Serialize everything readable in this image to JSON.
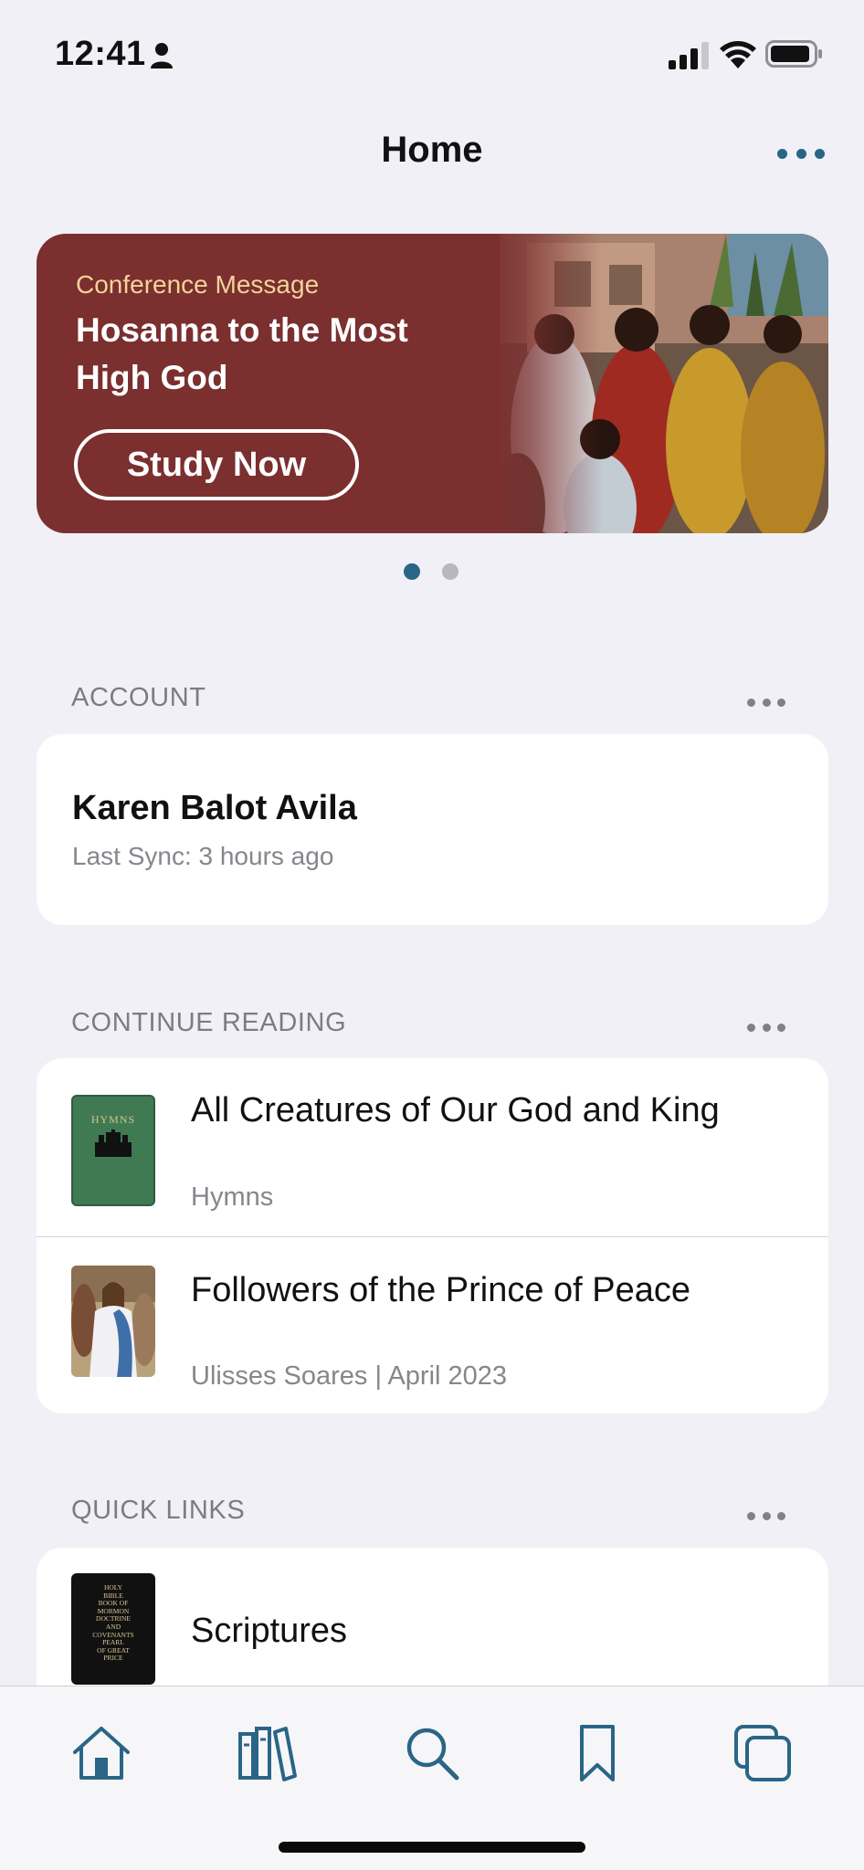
{
  "status_bar": {
    "time": "12:41"
  },
  "nav": {
    "title": "Home"
  },
  "banner": {
    "eyebrow": "Conference Message",
    "title": "Hosanna to the Most High God",
    "cta_label": "Study Now",
    "bg_color": "#7b2f2f",
    "eyebrow_color": "#f3d39a"
  },
  "pager": {
    "count": 2,
    "active": 1
  },
  "account": {
    "header": "ACCOUNT",
    "name": "Karen Balot Avila",
    "last_sync": "Last Sync: 3 hours ago"
  },
  "continue_reading": {
    "header": "CONTINUE READING",
    "items": [
      {
        "title": "All Creatures of Our God and King",
        "subtitle": "Hymns",
        "thumb": "hymns-book-cover",
        "thumb_text": "HYMNS"
      },
      {
        "title": "Followers of the Prince of Peace",
        "subtitle": "Ulisses Soares | April 2023",
        "thumb": "christ-painting"
      }
    ]
  },
  "quick_links": {
    "header": "QUICK LINKS",
    "items": [
      {
        "title": "Scriptures",
        "thumb": "scriptures-cover",
        "thumb_lines": [
          "HOLY",
          "BIBLE",
          "BOOK OF",
          "MORMON",
          "DOCTRINE",
          "AND",
          "COVENANTS",
          "PEARL",
          "OF GREAT",
          "PRICE"
        ]
      }
    ]
  },
  "tab_bar": {
    "tabs": [
      {
        "name": "home",
        "icon": "home-icon",
        "active": true
      },
      {
        "name": "library",
        "icon": "library-icon"
      },
      {
        "name": "search",
        "icon": "search-icon"
      },
      {
        "name": "bookmarks",
        "icon": "bookmark-icon"
      },
      {
        "name": "screens",
        "icon": "screens-icon"
      }
    ],
    "accent": "#2a6587"
  }
}
